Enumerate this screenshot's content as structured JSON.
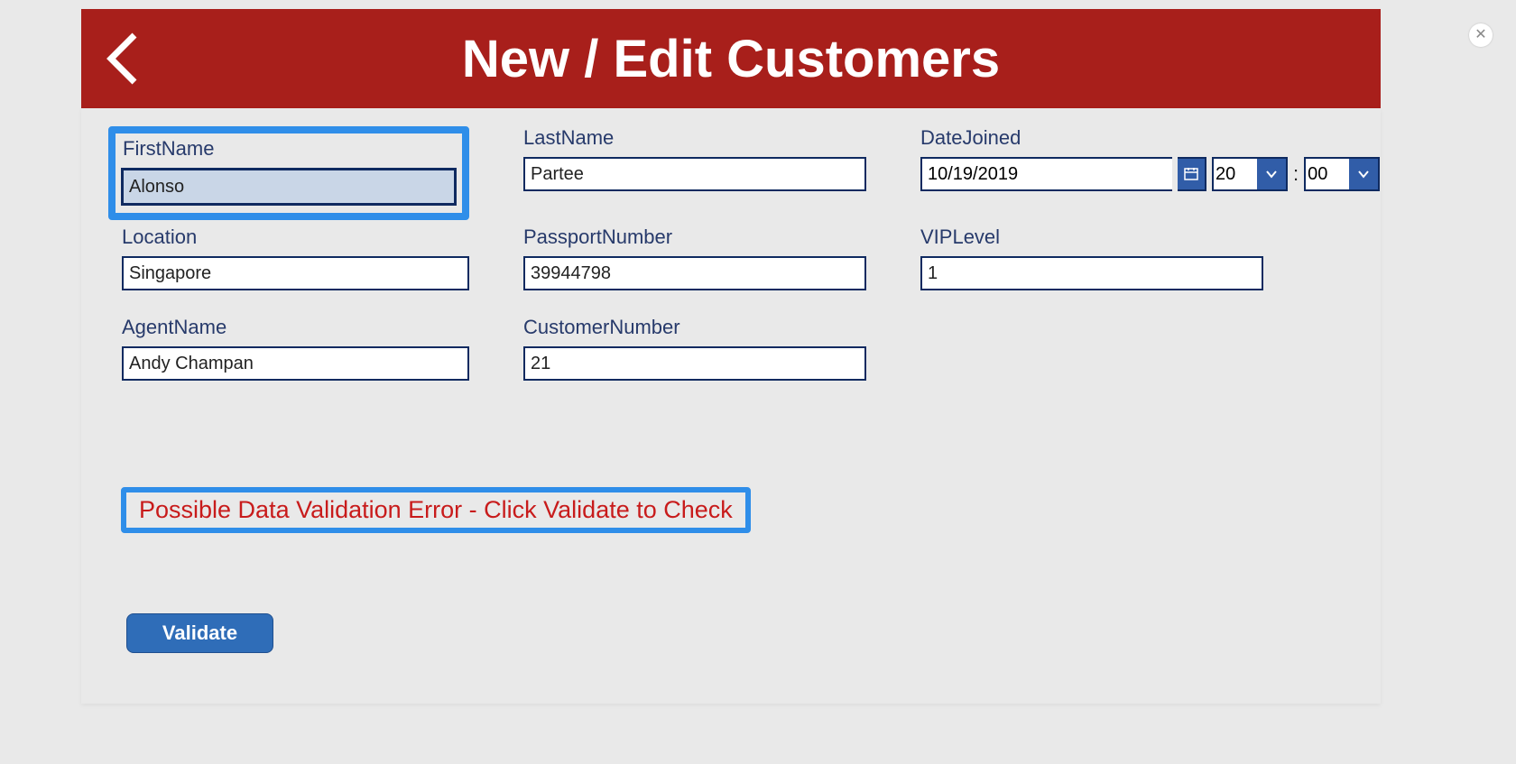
{
  "header": {
    "title": "New / Edit Customers"
  },
  "fields": {
    "firstName": {
      "label": "FirstName",
      "value": "Alonso"
    },
    "lastName": {
      "label": "LastName",
      "value": "Partee"
    },
    "dateJoined": {
      "label": "DateJoined",
      "value": "10/19/2019",
      "hour": "20",
      "minute": "00",
      "separator": ":"
    },
    "location": {
      "label": "Location",
      "value": "Singapore"
    },
    "passportNumber": {
      "label": "PassportNumber",
      "value": "39944798"
    },
    "vipLevel": {
      "label": "VIPLevel",
      "value": "1"
    },
    "agentName": {
      "label": "AgentName",
      "value": "Andy Champan"
    },
    "customerNumber": {
      "label": "CustomerNumber",
      "value": "21"
    }
  },
  "status": {
    "message": "Possible Data Validation Error - Click Validate to Check"
  },
  "buttons": {
    "validate": "Validate"
  },
  "close": {
    "label": "✕"
  }
}
